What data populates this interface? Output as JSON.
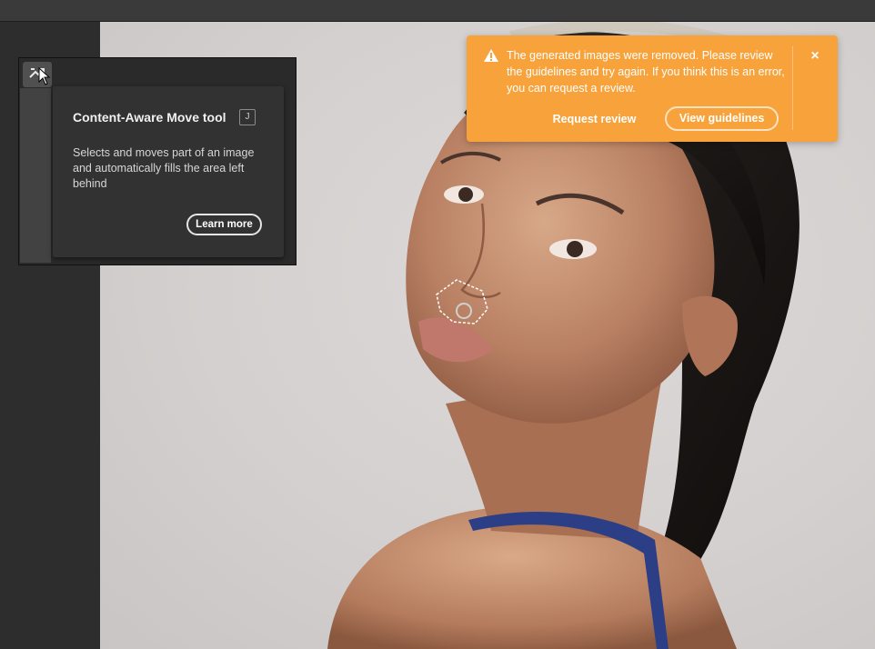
{
  "tooltip": {
    "title": "Content-Aware Move tool",
    "shortcut": "J",
    "description": "Selects and moves part of an image and automatically fills the area left behind",
    "learn_more": "Learn more"
  },
  "toast": {
    "message": "The generated images were removed. Please review the guidelines and try again. If you think this is an error, you can request a review.",
    "request_review": "Request review",
    "view_guidelines": "View guidelines",
    "close_symbol": "×",
    "color": "#f7a23a"
  },
  "icons": {
    "tool": "content-aware-move-icon",
    "warning": "warning-icon",
    "cursor": "mouse-cursor-icon"
  }
}
